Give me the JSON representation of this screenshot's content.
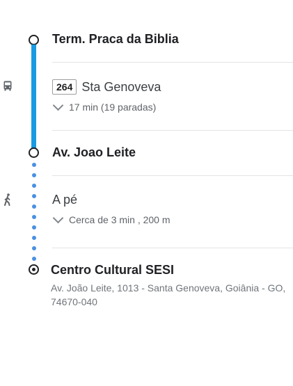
{
  "origin": {
    "name": "Term. Praca da Biblia"
  },
  "transit": {
    "route_number": "264",
    "headsign": "Sta Genoveva",
    "duration_text": "17 min (19 paradas)"
  },
  "transfer": {
    "name": "Av. Joao Leite"
  },
  "walk": {
    "label": "A pé",
    "detail_text": "Cerca de 3 min , 200 m"
  },
  "destination": {
    "name": "Centro Cultural SESI",
    "address": "Av. João Leite, 1013 - Santa Genoveva, Goiânia - GO, 74670-040"
  },
  "colors": {
    "transit_line": "#1a9ae0",
    "walk_dots": "#4a90e2",
    "text_primary": "#202124",
    "text_secondary": "#5f6368"
  },
  "icons": [
    "bus-icon",
    "walk-icon",
    "chevron-down-icon",
    "destination-pin-icon"
  ]
}
